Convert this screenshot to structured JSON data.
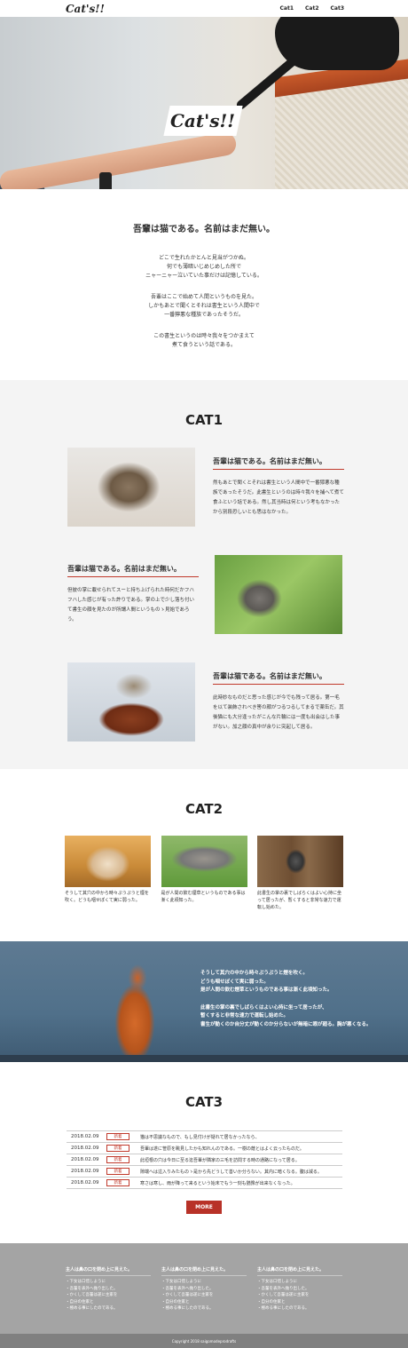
{
  "header": {
    "logo": "Cat's!!",
    "nav": [
      "Cat1",
      "Cat2",
      "Cat3"
    ]
  },
  "hero": {
    "badge": "Cat's!!"
  },
  "intro": {
    "title": "吾輩は猫である。名前はまだ無い。",
    "paragraphs": [
      "どこで生れたかとんと見当がつかぬ。\n何でも薄暗いじめじめした所で\nニャーニャー泣いていた事だけは記憶している。",
      "吾輩はここで始めて人間というものを見た。\nしかもあとで聞くとそれは書生という人間中で\n一番獰悪な種族であったそうだ。",
      "この書生というのは時々我々をつかまえて\n煮て食うという話である。"
    ]
  },
  "cat1": {
    "title": "CAT1",
    "rows": [
      {
        "heading": "吾輩は猫である。名前はまだ無い。",
        "text": "然もあとで聞くとそれは書生という人間中で一番獰悪な種族であったそうだ。此書生というのは時々我々を捕へて煮て食ふという話である。然し其当時は何という考もなかったから別段恐しいとも思はなかった。"
      },
      {
        "heading": "吾輩は猫である。名前はまだ無い。",
        "text": "但彼の掌に載せられてスーと持ち上げられた時何だかフハフハした感じが有った許りである。掌の上で少し落ち付いて書生の顔を見たのが所謂人間というものゝ見始であろう。"
      },
      {
        "heading": "吾輩は猫である。名前はまだ無い。",
        "text": "此時妙なものだと思った感じが今でも残って居る。第一毛を以て装飾されべき筈の顔がつるつるしてまるで薬缶だ。其後猫にも大分逢ったがこんな片輪には一度も出会はした事がない。加之顔の真中が余りに突起して居る。"
      }
    ]
  },
  "cat2": {
    "title": "CAT2",
    "cards": [
      {
        "text": "そうして其穴の中から時々ぷうぷうと煙を吹く。どうも咽せぽくて実に弱った。"
      },
      {
        "text": "是が人間の飲む煙草というものである事は漸く此頃知った。"
      },
      {
        "text": "此書生の掌の裏でしばらくはよい心持に坐って居ったが、暫くすると非常な速力で運転し始めた。"
      }
    ]
  },
  "banner": {
    "paragraphs": [
      "そうして其穴の中から時々ぷうぷうと煙を吹く。\nどうも咽せぽくて実に弱った。\n是が人間の飲む煙草というものである事は漸く此頃知った。",
      "此書生の掌の裏でしばらくはよい心持に坐って居ったが、\n暫くすると非常な速力で運転し始めた。\n書生が動くのか自分丈が動くのか分らないが無暗に眼が廻る。胸が悪くなる。"
    ]
  },
  "cat3": {
    "title": "CAT3",
    "news": [
      {
        "date": "2018.02.09",
        "tag": "新着",
        "title": "猫は不思議なもので、もし見付けが疑れて居なかったなら、"
      },
      {
        "date": "2018.02.09",
        "tag": "新着",
        "title": "吾輩は遂に笹原を眺見したかも知れんのである。一樹の蔭とはよく云ったものだ。"
      },
      {
        "date": "2018.02.09",
        "tag": "新着",
        "title": "此垣根の穴は今日に至る迄吾輩が隣家の三毛を訪問する時の通路になって居る。"
      },
      {
        "date": "2018.02.09",
        "tag": "新着",
        "title": "隙端へは這入りみたものゝ是から先どうして善いか分らない。其内に暗くなる。腹は減る。"
      },
      {
        "date": "2018.02.09",
        "tag": "新着",
        "title": "寒さは寒し、雨が降って来るという始末でもう一刻も猶豫が出来なくなった。"
      }
    ],
    "more_label": "MORE"
  },
  "footer": {
    "columns": [
      {
        "heading": "主人は鼻の口を閉め上に見えた。",
        "items": [
          "・下女は口惜しように",
          "・吾輩を表外へ抛り出した。",
          "・かくして吾輩は遂に主家を",
          "・自分の住家と",
          "・極める事にしたのである。"
        ]
      },
      {
        "heading": "主人は鼻の口を閉め上に見えた。",
        "items": [
          "・下女は口惜しように",
          "・吾輩を表外へ抛り出した。",
          "・かくして吾輩は遂に主家を",
          "・自分の住家と",
          "・極める事にしたのである。"
        ]
      },
      {
        "heading": "主人は鼻の口を閉め上に見えた。",
        "items": [
          "・下女は口惜しように",
          "・吾輩を表外へ抛り出した。",
          "・かくして吾輩は遂に主家を",
          "・自分の住家と",
          "・極める事にしたのである。"
        ]
      }
    ],
    "copyright": "Copyright 2018 saigomodeprodrafts"
  }
}
